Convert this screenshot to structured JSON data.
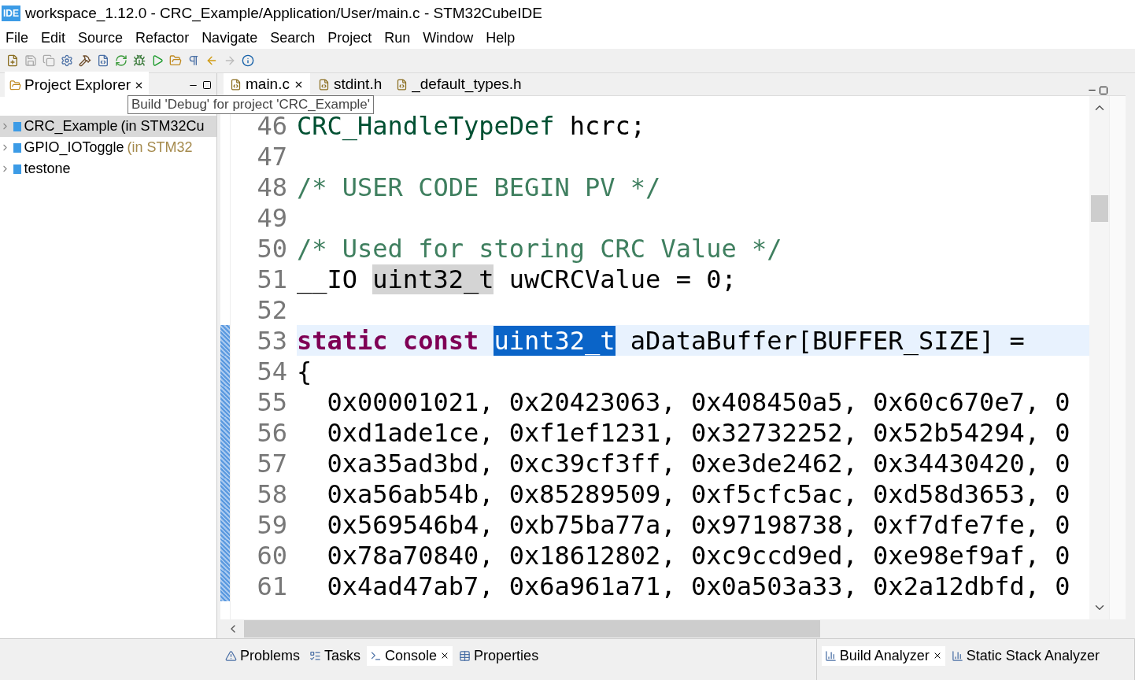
{
  "window": {
    "app_badge": "IDE",
    "title": "workspace_1.12.0 - CRC_Example/Application/User/main.c - STM32CubeIDE"
  },
  "menu": [
    "File",
    "Edit",
    "Source",
    "Refactor",
    "Navigate",
    "Search",
    "Project",
    "Run",
    "Window",
    "Help"
  ],
  "project_explorer": {
    "title": "Project Explorer",
    "items": [
      {
        "name": "CRC_Example",
        "suffix": "(in STM32Cu",
        "selected": true
      },
      {
        "name": "GPIO_IOToggle",
        "suffix": "(in STM32",
        "selected": false
      },
      {
        "name": "testone",
        "selected": false
      }
    ]
  },
  "tooltip": "Build 'Debug' for project 'CRC_Example'",
  "editor": {
    "tabs": [
      {
        "label": "main.c",
        "selected": true
      },
      {
        "label": "stdint.h",
        "selected": false
      },
      {
        "label": "_default_types.h",
        "selected": false
      }
    ],
    "lines": [
      {
        "number": "46",
        "current": false,
        "tokens": [
          {
            "kind": "type",
            "text": "CRC_HandleTypeDef"
          },
          {
            "kind": "plain",
            "text": " hcrc;"
          }
        ]
      },
      {
        "number": "47",
        "current": false
      },
      {
        "number": "48",
        "current": false,
        "tokens": [
          {
            "kind": "comment",
            "text": "/* USER CODE BEGIN PV */"
          }
        ]
      },
      {
        "number": "49",
        "current": false
      },
      {
        "number": "50",
        "current": false,
        "tokens": [
          {
            "kind": "comment",
            "text": "/* Used for storing CRC Value */"
          }
        ]
      },
      {
        "number": "51",
        "current": false,
        "tokens": [
          {
            "kind": "plain",
            "text": "__IO "
          },
          {
            "kind": "occurrence",
            "text": "uint32_t"
          },
          {
            "kind": "plain",
            "text": " uwCRCValue = 0;"
          }
        ]
      },
      {
        "number": "52",
        "current": false
      },
      {
        "number": "53",
        "current": true,
        "tokens": [
          {
            "kind": "keyword",
            "text": "static const "
          },
          {
            "kind": "selection",
            "text": "uint32_t"
          },
          {
            "kind": "plain",
            "text": " aDataBuffer[BUFFER_SIZE] ="
          }
        ]
      },
      {
        "number": "54",
        "current": false,
        "tokens": [
          {
            "kind": "plain",
            "text": "{"
          }
        ]
      },
      {
        "number": "55",
        "current": false,
        "tokens": [
          {
            "kind": "plain",
            "text": "  0x00001021, 0x20423063, 0x408450a5, 0x60c670e7, 0"
          }
        ]
      },
      {
        "number": "56",
        "current": false,
        "tokens": [
          {
            "kind": "plain",
            "text": "  0xd1ade1ce, 0xf1ef1231, 0x32732252, 0x52b54294, 0"
          }
        ]
      },
      {
        "number": "57",
        "current": false,
        "tokens": [
          {
            "kind": "plain",
            "text": "  0xa35ad3bd, 0xc39cf3ff, 0xe3de2462, 0x34430420, 0"
          }
        ]
      },
      {
        "number": "58",
        "current": false,
        "tokens": [
          {
            "kind": "plain",
            "text": "  0xa56ab54b, 0x85289509, 0xf5cfc5ac, 0xd58d3653, 0"
          }
        ]
      },
      {
        "number": "59",
        "current": false,
        "tokens": [
          {
            "kind": "plain",
            "text": "  0x569546b4, 0xb75ba77a, 0x97198738, 0xf7dfe7fe, 0"
          }
        ]
      },
      {
        "number": "60",
        "current": false,
        "tokens": [
          {
            "kind": "plain",
            "text": "  0x78a70840, 0x18612802, 0xc9ccd9ed, 0xe98ef9af, 0"
          }
        ]
      },
      {
        "number": "61",
        "current": false,
        "tokens": [
          {
            "kind": "plain",
            "text": "  0x4ad47ab7, 0x6a961a71, 0x0a503a33, 0x2a12dbfd, 0"
          }
        ]
      }
    ]
  },
  "bottom_tabs": [
    {
      "label": "Problems",
      "selected": false
    },
    {
      "label": "Tasks",
      "selected": false
    },
    {
      "label": "Console",
      "selected": true
    },
    {
      "label": "Properties",
      "selected": false
    }
  ],
  "right_bottom_tabs": [
    {
      "label": "Build Analyzer",
      "selected": true
    },
    {
      "label": "Static Stack Analyzer",
      "selected": false
    }
  ]
}
